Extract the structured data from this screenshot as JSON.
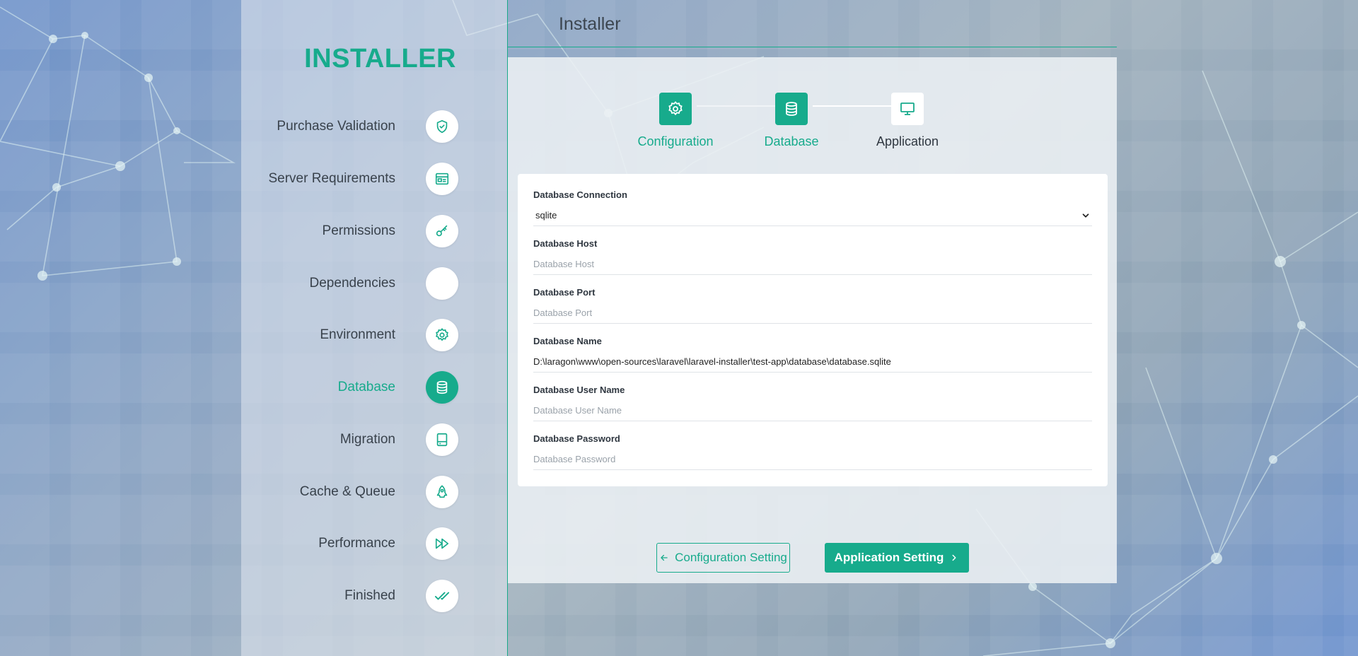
{
  "brand": "INSTALLER",
  "header": {
    "title": "Installer"
  },
  "colors": {
    "accent": "#17ab8c",
    "text": "#39424c"
  },
  "sidebar": {
    "items": [
      {
        "label": "Purchase Validation",
        "icon": "shield-check-icon",
        "active": false
      },
      {
        "label": "Server Requirements",
        "icon": "server-window-icon",
        "active": false
      },
      {
        "label": "Permissions",
        "icon": "key-icon",
        "active": false
      },
      {
        "label": "Dependencies",
        "icon": "blank-icon",
        "active": false
      },
      {
        "label": "Environment",
        "icon": "gear-icon",
        "active": false
      },
      {
        "label": "Database",
        "icon": "database-icon",
        "active": true
      },
      {
        "label": "Migration",
        "icon": "hard-drive-icon",
        "active": false
      },
      {
        "label": "Cache & Queue",
        "icon": "rocket-icon",
        "active": false
      },
      {
        "label": "Performance",
        "icon": "fast-forward-icon",
        "active": false
      },
      {
        "label": "Finished",
        "icon": "double-check-icon",
        "active": false
      }
    ]
  },
  "steps": [
    {
      "label": "Configuration",
      "icon": "gear-icon",
      "done": true
    },
    {
      "label": "Database",
      "icon": "database-icon",
      "done": true
    },
    {
      "label": "Application",
      "icon": "monitor-icon",
      "done": false
    }
  ],
  "form": {
    "connection": {
      "label": "Database Connection",
      "value": "sqlite",
      "options": [
        "sqlite"
      ]
    },
    "host": {
      "label": "Database Host",
      "value": "",
      "placeholder": "Database Host"
    },
    "port": {
      "label": "Database Port",
      "value": "",
      "placeholder": "Database Port"
    },
    "name": {
      "label": "Database Name",
      "value": "D:\\laragon\\www\\open-sources\\laravel\\laravel-installer\\test-app\\database\\database.sqlite",
      "placeholder": "Database Name"
    },
    "username": {
      "label": "Database User Name",
      "value": "",
      "placeholder": "Database User Name"
    },
    "password": {
      "label": "Database Password",
      "value": "",
      "placeholder": "Database Password"
    }
  },
  "buttons": {
    "back_label": "Configuration Setting",
    "next_label": "Application Setting"
  }
}
